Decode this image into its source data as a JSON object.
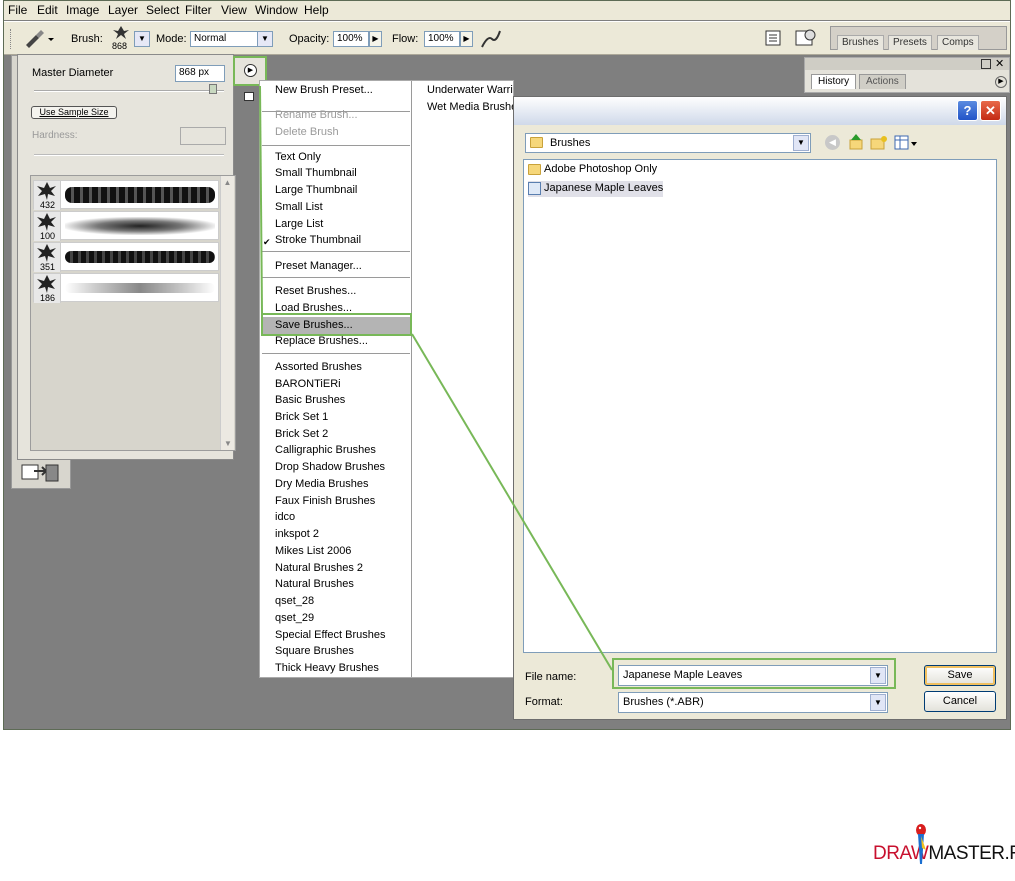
{
  "menubar": [
    "File",
    "Edit",
    "Image",
    "Layer",
    "Select",
    "Filter",
    "View",
    "Window",
    "Help"
  ],
  "options": {
    "brush_label": "Brush:",
    "brush_size": "868",
    "mode_label": "Mode:",
    "mode_value": "Normal",
    "opacity_label": "Opacity:",
    "opacity_value": "100%",
    "flow_label": "Flow:",
    "flow_value": "100%"
  },
  "well_tabs": [
    "Brushes",
    "Presets",
    "Comps"
  ],
  "history_tabs": [
    "History",
    "Actions"
  ],
  "picker": {
    "master_diameter_label": "Master Diameter",
    "master_diameter_value": "868 px",
    "use_sample_size": "Use Sample Size",
    "hardness_label": "Hardness:",
    "brushes": [
      {
        "size": "432"
      },
      {
        "size": "100"
      },
      {
        "size": "351"
      },
      {
        "size": "186"
      }
    ]
  },
  "menu": {
    "left": [
      {
        "label": "New Brush Preset...",
        "disabled": false
      },
      {
        "label": "Rename Brush...",
        "disabled": true
      },
      {
        "label": "Delete Brush",
        "disabled": true
      },
      {
        "label": "Text Only",
        "disabled": false
      },
      {
        "label": "Small Thumbnail",
        "disabled": false
      },
      {
        "label": "Large Thumbnail",
        "disabled": false
      },
      {
        "label": "Small List",
        "disabled": false
      },
      {
        "label": "Large List",
        "disabled": false
      },
      {
        "label": "Stroke Thumbnail",
        "disabled": false,
        "checked": true
      },
      {
        "label": "Preset Manager...",
        "disabled": false
      },
      {
        "label": "Reset Brushes...",
        "disabled": false
      },
      {
        "label": "Load Brushes...",
        "disabled": false
      },
      {
        "label": "Save Brushes...",
        "disabled": false,
        "highlighted": true
      },
      {
        "label": "Replace Brushes...",
        "disabled": false
      },
      {
        "label": "Assorted Brushes"
      },
      {
        "label": "BARONTiERi"
      },
      {
        "label": "Basic Brushes"
      },
      {
        "label": "Brick Set 1"
      },
      {
        "label": "Brick Set 2"
      },
      {
        "label": "Calligraphic Brushes"
      },
      {
        "label": "Drop Shadow Brushes"
      },
      {
        "label": "Dry Media Brushes"
      },
      {
        "label": "Faux Finish Brushes"
      },
      {
        "label": "idco"
      },
      {
        "label": "inkspot 2"
      },
      {
        "label": "Mikes List 2006"
      },
      {
        "label": "Natural Brushes 2"
      },
      {
        "label": "Natural Brushes"
      },
      {
        "label": "qset_28"
      },
      {
        "label": "qset_29"
      },
      {
        "label": "Special Effect Brushes"
      },
      {
        "label": "Square Brushes"
      },
      {
        "label": "Thick Heavy Brushes"
      }
    ],
    "right": [
      "Underwater Warri",
      "Wet Media Brushe"
    ]
  },
  "dialog": {
    "help_button": "?",
    "close_button": "✕",
    "look_in": "Brushes",
    "files": [
      {
        "name": "Adobe Photoshop Only",
        "type": "folder"
      },
      {
        "name": "Japanese Maple Leaves",
        "type": "brush"
      }
    ],
    "file_name_label": "File name:",
    "file_name_value": "Japanese Maple Leaves",
    "format_label": "Format:",
    "format_value": "Brushes (*.ABR)",
    "save_button": "Save",
    "cancel_button": "Cancel"
  },
  "logo": {
    "part1": "DRAW",
    "part2": "MASTER.RU"
  },
  "colors": {
    "highlight_green": "#78b858",
    "logo_red": "#c8102e"
  }
}
